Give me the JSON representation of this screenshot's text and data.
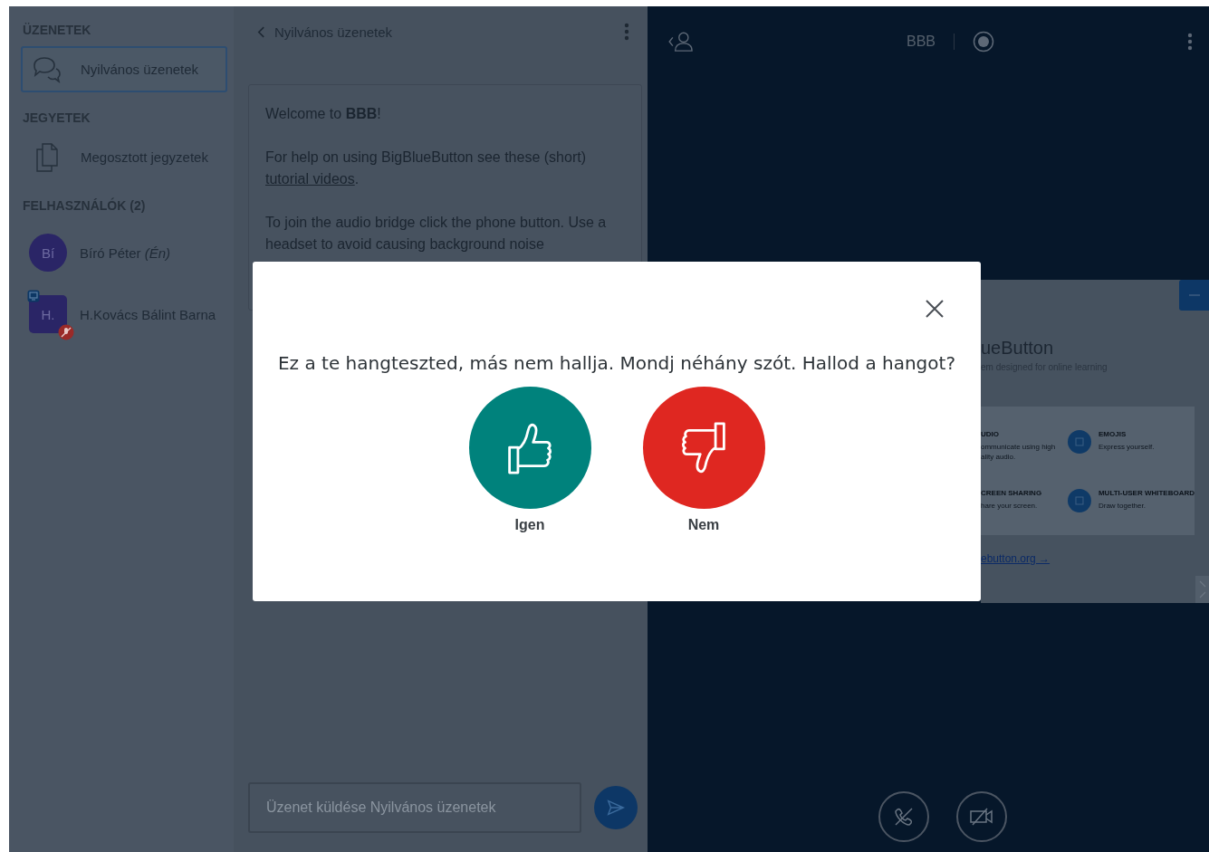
{
  "sidebar": {
    "sections": [
      {
        "heading": "ÜZENETEK",
        "items": [
          {
            "label": "Nyilvános üzenetek",
            "kind": "chat",
            "selected": true
          }
        ]
      },
      {
        "heading": "JEGYETEK",
        "items": [
          {
            "label": "Megosztott jegyzetek",
            "kind": "notes",
            "selected": false
          }
        ]
      }
    ],
    "users_heading": "FELHASZNÁLÓK (2)",
    "users": [
      {
        "initials": "Bí",
        "name": "Bíró Péter *(Én)*",
        "kind": "circle",
        "presenter": false,
        "muted": false
      },
      {
        "initials": "H.",
        "name": "H.Kovács Bálint Barna",
        "kind": "square",
        "presenter": true,
        "muted": true
      }
    ]
  },
  "chat": {
    "title": "Nyilvános üzenetek",
    "paragraphs": [
      {
        "text": "Welcome to **BBB**!"
      },
      {
        "text": "For help on using BigBlueButton see these (short) ",
        "link": "tutorial videos",
        "after": "."
      },
      {
        "text": "To join the audio bridge click the phone button. Use a headset to avoid causing background noise"
      }
    ],
    "input": {
      "placeholder": "Üzenet küldése Nyilvános üzenetek"
    }
  },
  "presentation": {
    "title": "BBB",
    "recording": false,
    "slide": {
      "title": "ueButton",
      "subtitle": "em designed for online learning",
      "features": [
        {
          "title": "UDIO",
          "lines": [
            "ommunicate using high",
            "ality audio."
          ],
          "kind": "clipped"
        },
        {
          "title": "EMOJIS",
          "lines": [
            "Express yourself."
          ],
          "kind": "full"
        },
        {
          "title": "CREEN SHARING",
          "lines": [
            "hare your screen."
          ],
          "kind": "clipped"
        },
        {
          "title": "MULTI-USER WHITEBOARD",
          "lines": [
            "Draw together."
          ],
          "kind": "full"
        }
      ],
      "link": "ebutton.org →"
    }
  },
  "modal": {
    "question": "Ez a te hangteszted, más nem hallja. Mondj néhány szót. Hallod a hangot?",
    "buttons": [
      {
        "label": "Igen",
        "kind": "yes"
      },
      {
        "label": "Nem",
        "kind": "no"
      }
    ]
  }
}
